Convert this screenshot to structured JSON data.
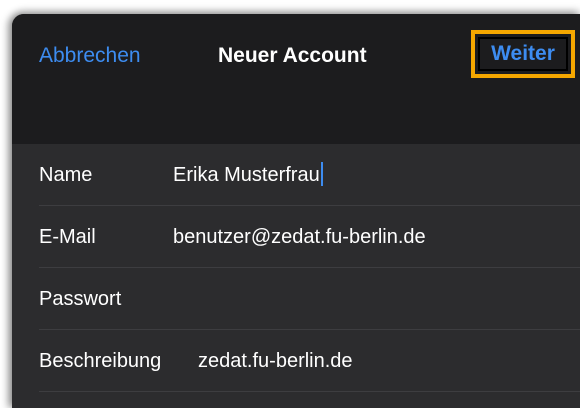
{
  "navbar": {
    "cancel_label": "Abbrechen",
    "title": "Neuer Account",
    "next_label": "Weiter"
  },
  "form": {
    "fields": [
      {
        "label": "Name",
        "value": "Erika Musterfrau"
      },
      {
        "label": "E-Mail",
        "value": "benutzer@zedat.fu-berlin.de"
      },
      {
        "label": "Passwort",
        "value": ""
      },
      {
        "label": "Beschreibung",
        "value": "zedat.fu-berlin.de"
      }
    ]
  },
  "colors": {
    "accent": "#3d8cf0",
    "highlight": "#f5a700",
    "sheet_background": "#1c1c1e",
    "form_background": "#2c2c2e"
  }
}
